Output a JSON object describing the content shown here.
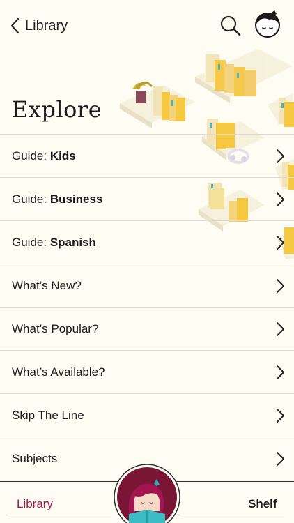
{
  "header": {
    "back_label": "Library",
    "back_icon": "chevron-left-icon",
    "search_icon": "search-icon",
    "avatar_icon": "libby-avatar-icon"
  },
  "page": {
    "title": "Explore"
  },
  "rows": [
    {
      "prefix": "Guide: ",
      "bold": "Kids"
    },
    {
      "prefix": "Guide: ",
      "bold": "Business"
    },
    {
      "prefix": "Guide: ",
      "bold": "Spanish"
    },
    {
      "prefix": "What’s New?",
      "bold": ""
    },
    {
      "prefix": "What’s Popular?",
      "bold": ""
    },
    {
      "prefix": "What’s Available?",
      "bold": ""
    },
    {
      "prefix": "Skip The Line",
      "bold": ""
    },
    {
      "prefix": "Subjects",
      "bold": ""
    }
  ],
  "tabbar": {
    "library_label": "Library",
    "shelf_label": "Shelf",
    "center_icon": "libby-reader-icon"
  },
  "colors": {
    "background": "#fefcf3",
    "accent": "#a3154f",
    "book_yellow": "#f5c842",
    "divider": "#dcdad2"
  }
}
